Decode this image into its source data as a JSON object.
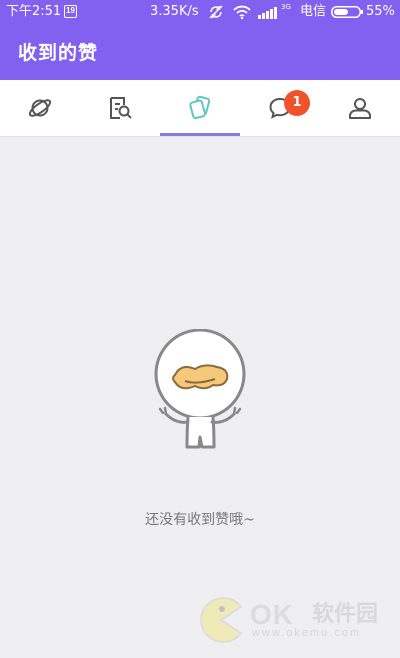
{
  "status_bar": {
    "time": "下午2:51",
    "notification_badge": "19",
    "speed": "3.35K/s",
    "network_type": "3G",
    "carrier": "电信",
    "battery": "55%"
  },
  "header": {
    "title": "收到的赞"
  },
  "tabs": [
    {
      "icon": "planet-icon"
    },
    {
      "icon": "search-document-icon"
    },
    {
      "icon": "cards-icon",
      "active": true
    },
    {
      "icon": "chat-bubble-icon",
      "badge": "1"
    },
    {
      "icon": "person-icon"
    }
  ],
  "empty_state": {
    "message": "还没有收到赞哦~"
  },
  "watermark": {
    "brand": "OK",
    "brand_cn": "软件园",
    "url": "www.okemu.com"
  },
  "colors": {
    "header": "#8260f0",
    "accent": "#8a7be0",
    "active_tab_icon": "#5ec7c2",
    "badge": "#f1522e",
    "background": "#efeff1"
  }
}
